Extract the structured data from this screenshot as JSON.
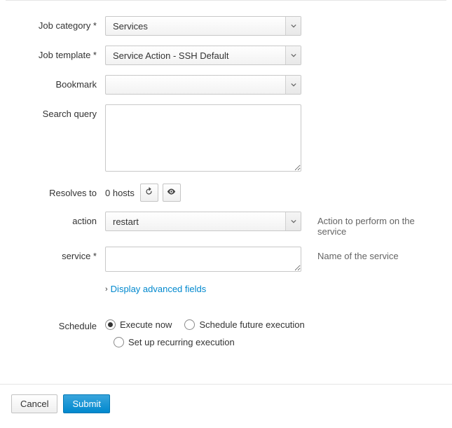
{
  "labels": {
    "job_category": "Job category *",
    "job_template": "Job template *",
    "bookmark": "Bookmark",
    "search_query": "Search query",
    "resolves_to": "Resolves to",
    "action": "action",
    "service": "service *",
    "schedule": "Schedule"
  },
  "fields": {
    "job_category": "Services",
    "job_template": "Service Action - SSH Default",
    "bookmark": "",
    "search_query": "",
    "resolves_to": "0 hosts",
    "action": "restart",
    "service": ""
  },
  "help": {
    "action": "Action to perform on the service",
    "service": "Name of the service"
  },
  "advanced_link": "Display advanced fields",
  "schedule_options": {
    "now": "Execute now",
    "future": "Schedule future execution",
    "recurring": "Set up recurring execution"
  },
  "buttons": {
    "cancel": "Cancel",
    "submit": "Submit"
  }
}
